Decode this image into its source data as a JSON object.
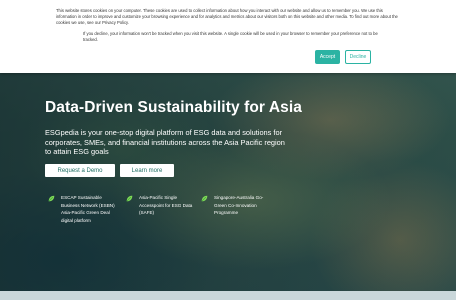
{
  "cookie_banner": {
    "text_main": "This website stores cookies on your computer. These cookies are used to collect information about how you interact with our website and allow us to remember you. We use this information in order to improve and customize your browsing experience and for analytics and metrics about our visitors both on this website and other media. To find out more about the cookies we use, see our Privacy Policy.",
    "text_decline": "If you decline, your information won't be tracked when you visit this website. A single cookie will be used in your browser to remember your preference not to be tracked.",
    "accept_label": "Accept",
    "decline_label": "Decline",
    "accent_color": "#2bb3a3"
  },
  "hero": {
    "title": "Data-Driven Sustainability for Asia",
    "subtitle": "ESGpedia is your one-stop digital platform of ESG data and solutions for corporates, SMEs, and financial institutions across the Asia Pacific region to attain ESG goals",
    "buttons": {
      "demo": "Request a Demo",
      "learn_more": "Learn more"
    },
    "features": [
      {
        "icon": "leaf-icon",
        "text": "ESCAP Sustainable Business Network (ESBN) Asia-Pacific Green Deal digital platform"
      },
      {
        "icon": "leaf-icon",
        "text": "Asia-Pacific Single Accesspoint for ESG Data (SAFE)"
      },
      {
        "icon": "leaf-icon",
        "text": "Singapore-Australia Go-Green Co-Innovation Programme"
      }
    ]
  }
}
